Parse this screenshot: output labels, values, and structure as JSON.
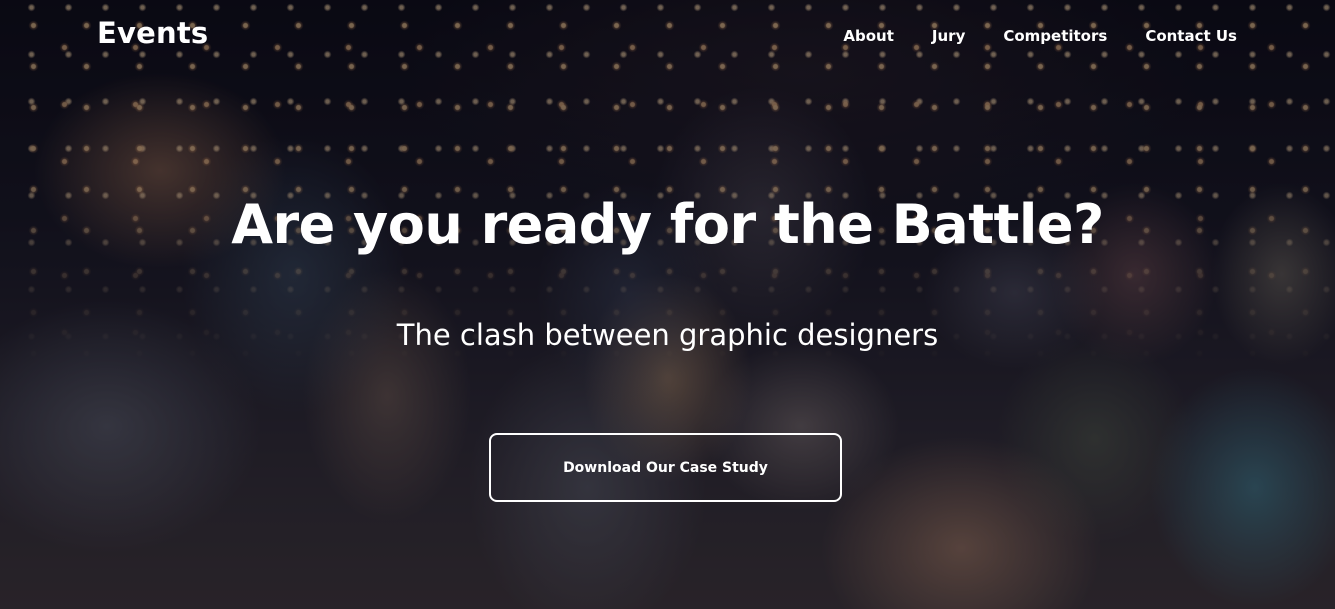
{
  "header": {
    "logo": "Events",
    "nav": [
      {
        "label": "About"
      },
      {
        "label": "Jury"
      },
      {
        "label": "Competitors"
      },
      {
        "label": "Contact Us"
      }
    ]
  },
  "hero": {
    "background": "concert-crowd-photo",
    "title": "Are you ready for the Battle?",
    "subtitle": "The clash between graphic designers",
    "cta_label": "Download Our Case Study"
  },
  "colors": {
    "text": "#ffffff",
    "overlay": "#0e0d18"
  }
}
